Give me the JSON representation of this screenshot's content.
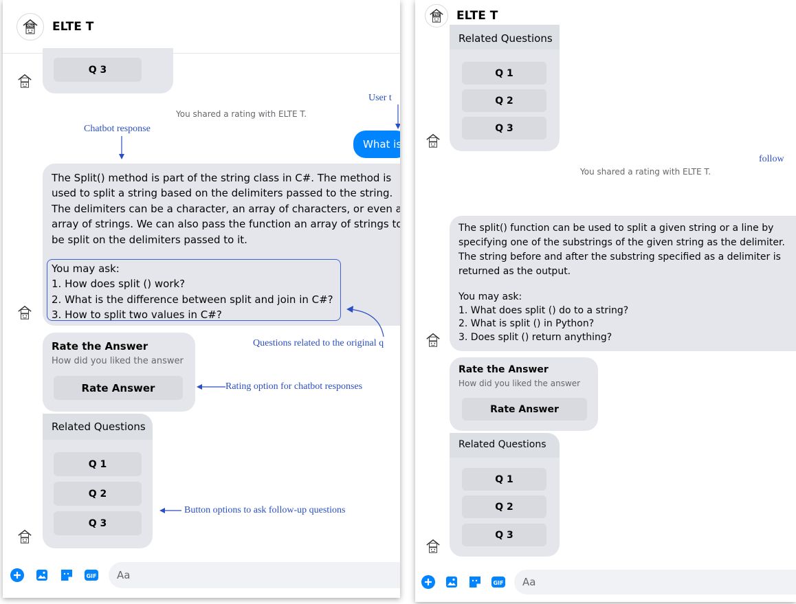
{
  "left": {
    "header": {
      "title": "ELTE T"
    },
    "top_button": "Q 3",
    "system_message": "You shared a rating with ELTE T.",
    "user_message": "What is",
    "bot_response": {
      "lines": [
        "The Split() method is part of the string class in C#. The method is",
        "used to split a string based on the delimiters passed to the string.",
        "The delimiters can be a character, an array of characters, or even an",
        "array of strings. We can also pass the function an array of strings to",
        "be split on the delimiters passed to it."
      ],
      "ask_lines": [
        "You may ask:",
        "1. How does split () work?",
        "2. What is the difference between split and join in C#?",
        "3. How to split two values in C#?"
      ]
    },
    "rating_card": {
      "title": "Rate the Answer",
      "subtitle": "How did you liked the answer",
      "button": "Rate Answer"
    },
    "related": {
      "title": "Related Questions",
      "buttons": [
        "Q 1",
        "Q 2",
        "Q 3"
      ]
    },
    "annotations": {
      "chatbot_response": "Chatbot response",
      "user_text": "User t",
      "questions_related": "Questions related to the original q",
      "rating_option": "Rating option for chatbot responses",
      "button_options": "Button options to ask follow-up questions"
    },
    "composer": {
      "placeholder": "Aa"
    }
  },
  "right": {
    "header": {
      "title": "ELTE T"
    },
    "related_top": {
      "title": "Related Questions",
      "buttons": [
        "Q 1",
        "Q 2",
        "Q 3"
      ]
    },
    "annotation_follow": "follow",
    "system_message": "You shared a rating with ELTE T.",
    "bot_response": {
      "lines": [
        "The split() function can be used to split a given string or a line by",
        "specifying one of the substrings of the given string as the delimiter.",
        "The string before and after the substring specified as a delimiter is",
        "returned as the output."
      ],
      "ask_lines": [
        "You may ask:",
        "1. What does split () do to a string?",
        "2. What is split () in Python?",
        "3. Does split () return anything?"
      ]
    },
    "rating_card": {
      "title": "Rate the Answer",
      "subtitle": "How did you liked the answer",
      "button": "Rate Answer"
    },
    "related": {
      "title": "Related Questions",
      "buttons": [
        "Q 1",
        "Q 2",
        "Q 3"
      ]
    },
    "composer": {
      "placeholder": "Aa"
    }
  },
  "colors": {
    "messenger_blue": "#0084ff",
    "bubble_gray": "#e4e6eb",
    "annotation_blue": "#2b4fc2"
  },
  "icons": [
    "bot-avatar-icon",
    "plus-icon",
    "image-icon",
    "sticker-icon",
    "gif-icon"
  ]
}
